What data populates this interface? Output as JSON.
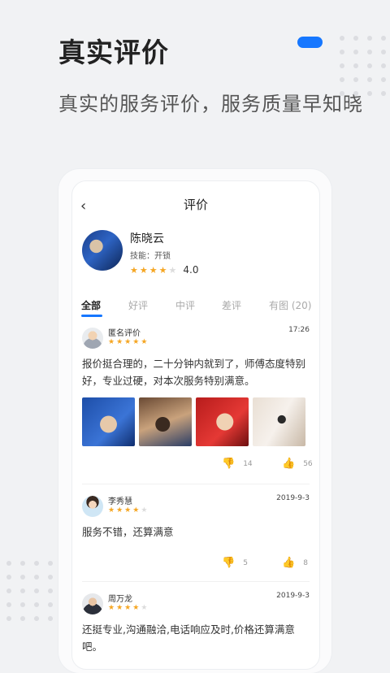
{
  "hero": {
    "title": "真实评价",
    "subtitle": "真实的服务评价，服务质量早知晓"
  },
  "nav": {
    "back_icon": "‹",
    "title": "评价"
  },
  "provider": {
    "name": "陈晓云",
    "skill": "技能：开锁",
    "stars": 4,
    "rating": "4.0"
  },
  "tabs": [
    {
      "label": "全部",
      "active": true
    },
    {
      "label": "好评",
      "active": false
    },
    {
      "label": "中评",
      "active": false
    },
    {
      "label": "差评",
      "active": false
    },
    {
      "label": "有图 (20)",
      "active": false
    }
  ],
  "reviews": [
    {
      "name": "匿名评价",
      "time": "17:26",
      "stars": 5,
      "text": "报价挺合理的，二十分钟内就到了，师傅态度特别好，专业过硬，对本次服务特别满意。",
      "has_photos": true,
      "dislikes": "14",
      "likes": "56",
      "liked": true
    },
    {
      "name": "李秀慧",
      "time": "2019-9-3",
      "stars": 4,
      "text": "服务不错，还算满意",
      "has_photos": false,
      "dislikes": "5",
      "likes": "8",
      "liked": false
    },
    {
      "name": "周万龙",
      "time": "2019-9-3",
      "stars": 4,
      "text": "还挺专业,沟通融洽,电话响应及时,价格还算满意吧。",
      "has_photos": false
    }
  ],
  "colors": {
    "accent": "#1677ff",
    "star": "#f5a623",
    "background": "#f1f2f4"
  }
}
